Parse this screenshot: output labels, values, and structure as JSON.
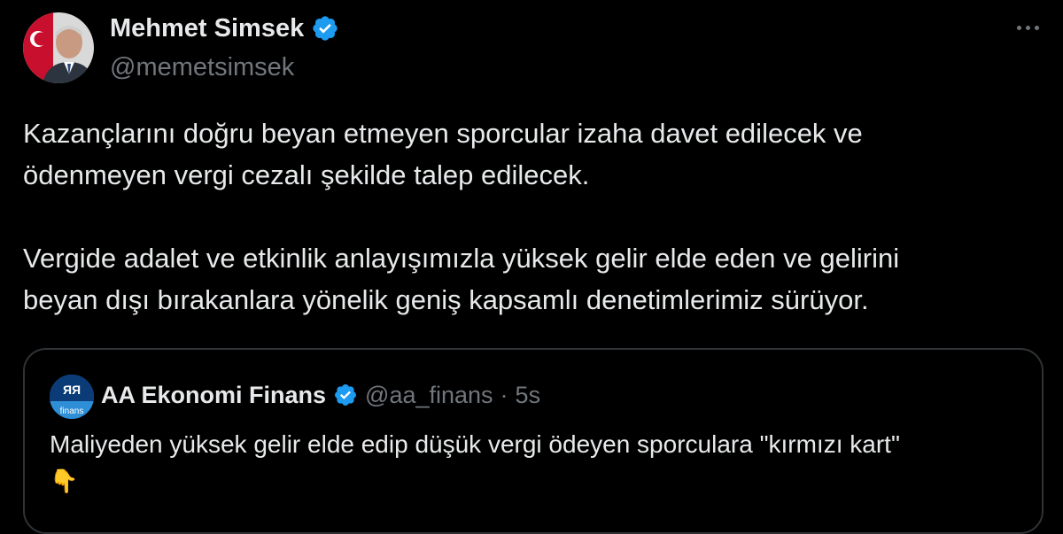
{
  "author": {
    "name": "Mehmet Simsek",
    "handle": "@memetsimsek",
    "verified_icon": "verified-badge-icon",
    "avatar_icon": "profile-photo"
  },
  "more_icon": "more-options-icon",
  "tweet": {
    "line1": "Kazançlarını doğru beyan etmeyen sporcular izaha davet edilecek ve",
    "line2": "ödenmeyen vergi cezalı şekilde talep edilecek.",
    "line3": "Vergide adalet ve etkinlik anlayışımızla yüksek gelir elde eden ve gelirini",
    "line4": "beyan dışı bırakanlara yönelik geniş kapsamlı denetimlerimiz sürüyor."
  },
  "quote": {
    "name": "AA Ekonomi Finans",
    "handle": "@aa_finans",
    "separator": "·",
    "time": "5s",
    "avatar_label": "finans",
    "text": "Maliyeden yüksek gelir elde edip düşük vergi ödeyen sporculara \"kırmızı kart\"",
    "emoji": "👇"
  },
  "colors": {
    "background": "#000000",
    "text": "#e7e9ea",
    "secondary": "#71767b",
    "verified": "#1d9bf0",
    "border": "#2f3336"
  }
}
